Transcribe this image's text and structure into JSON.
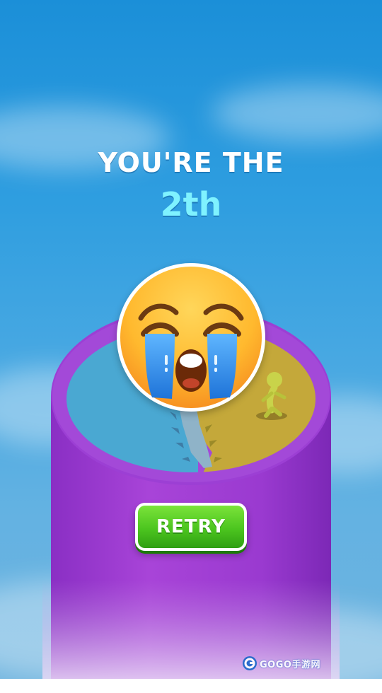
{
  "result": {
    "title": "YOU'RE THE",
    "rank": "2th"
  },
  "emoji": "loudly-crying-face",
  "actions": {
    "retry_label": "RETRY"
  },
  "watermark": {
    "text": "GOGO手游网"
  },
  "colors": {
    "sky": "#2f9ee0",
    "tower": "#a03ed0",
    "title": "#ffffff",
    "rank": "#7ff2ff",
    "retry": "#4cc51f",
    "arena_blue": "#4aa8d2",
    "arena_yellow": "#c4a83a"
  }
}
